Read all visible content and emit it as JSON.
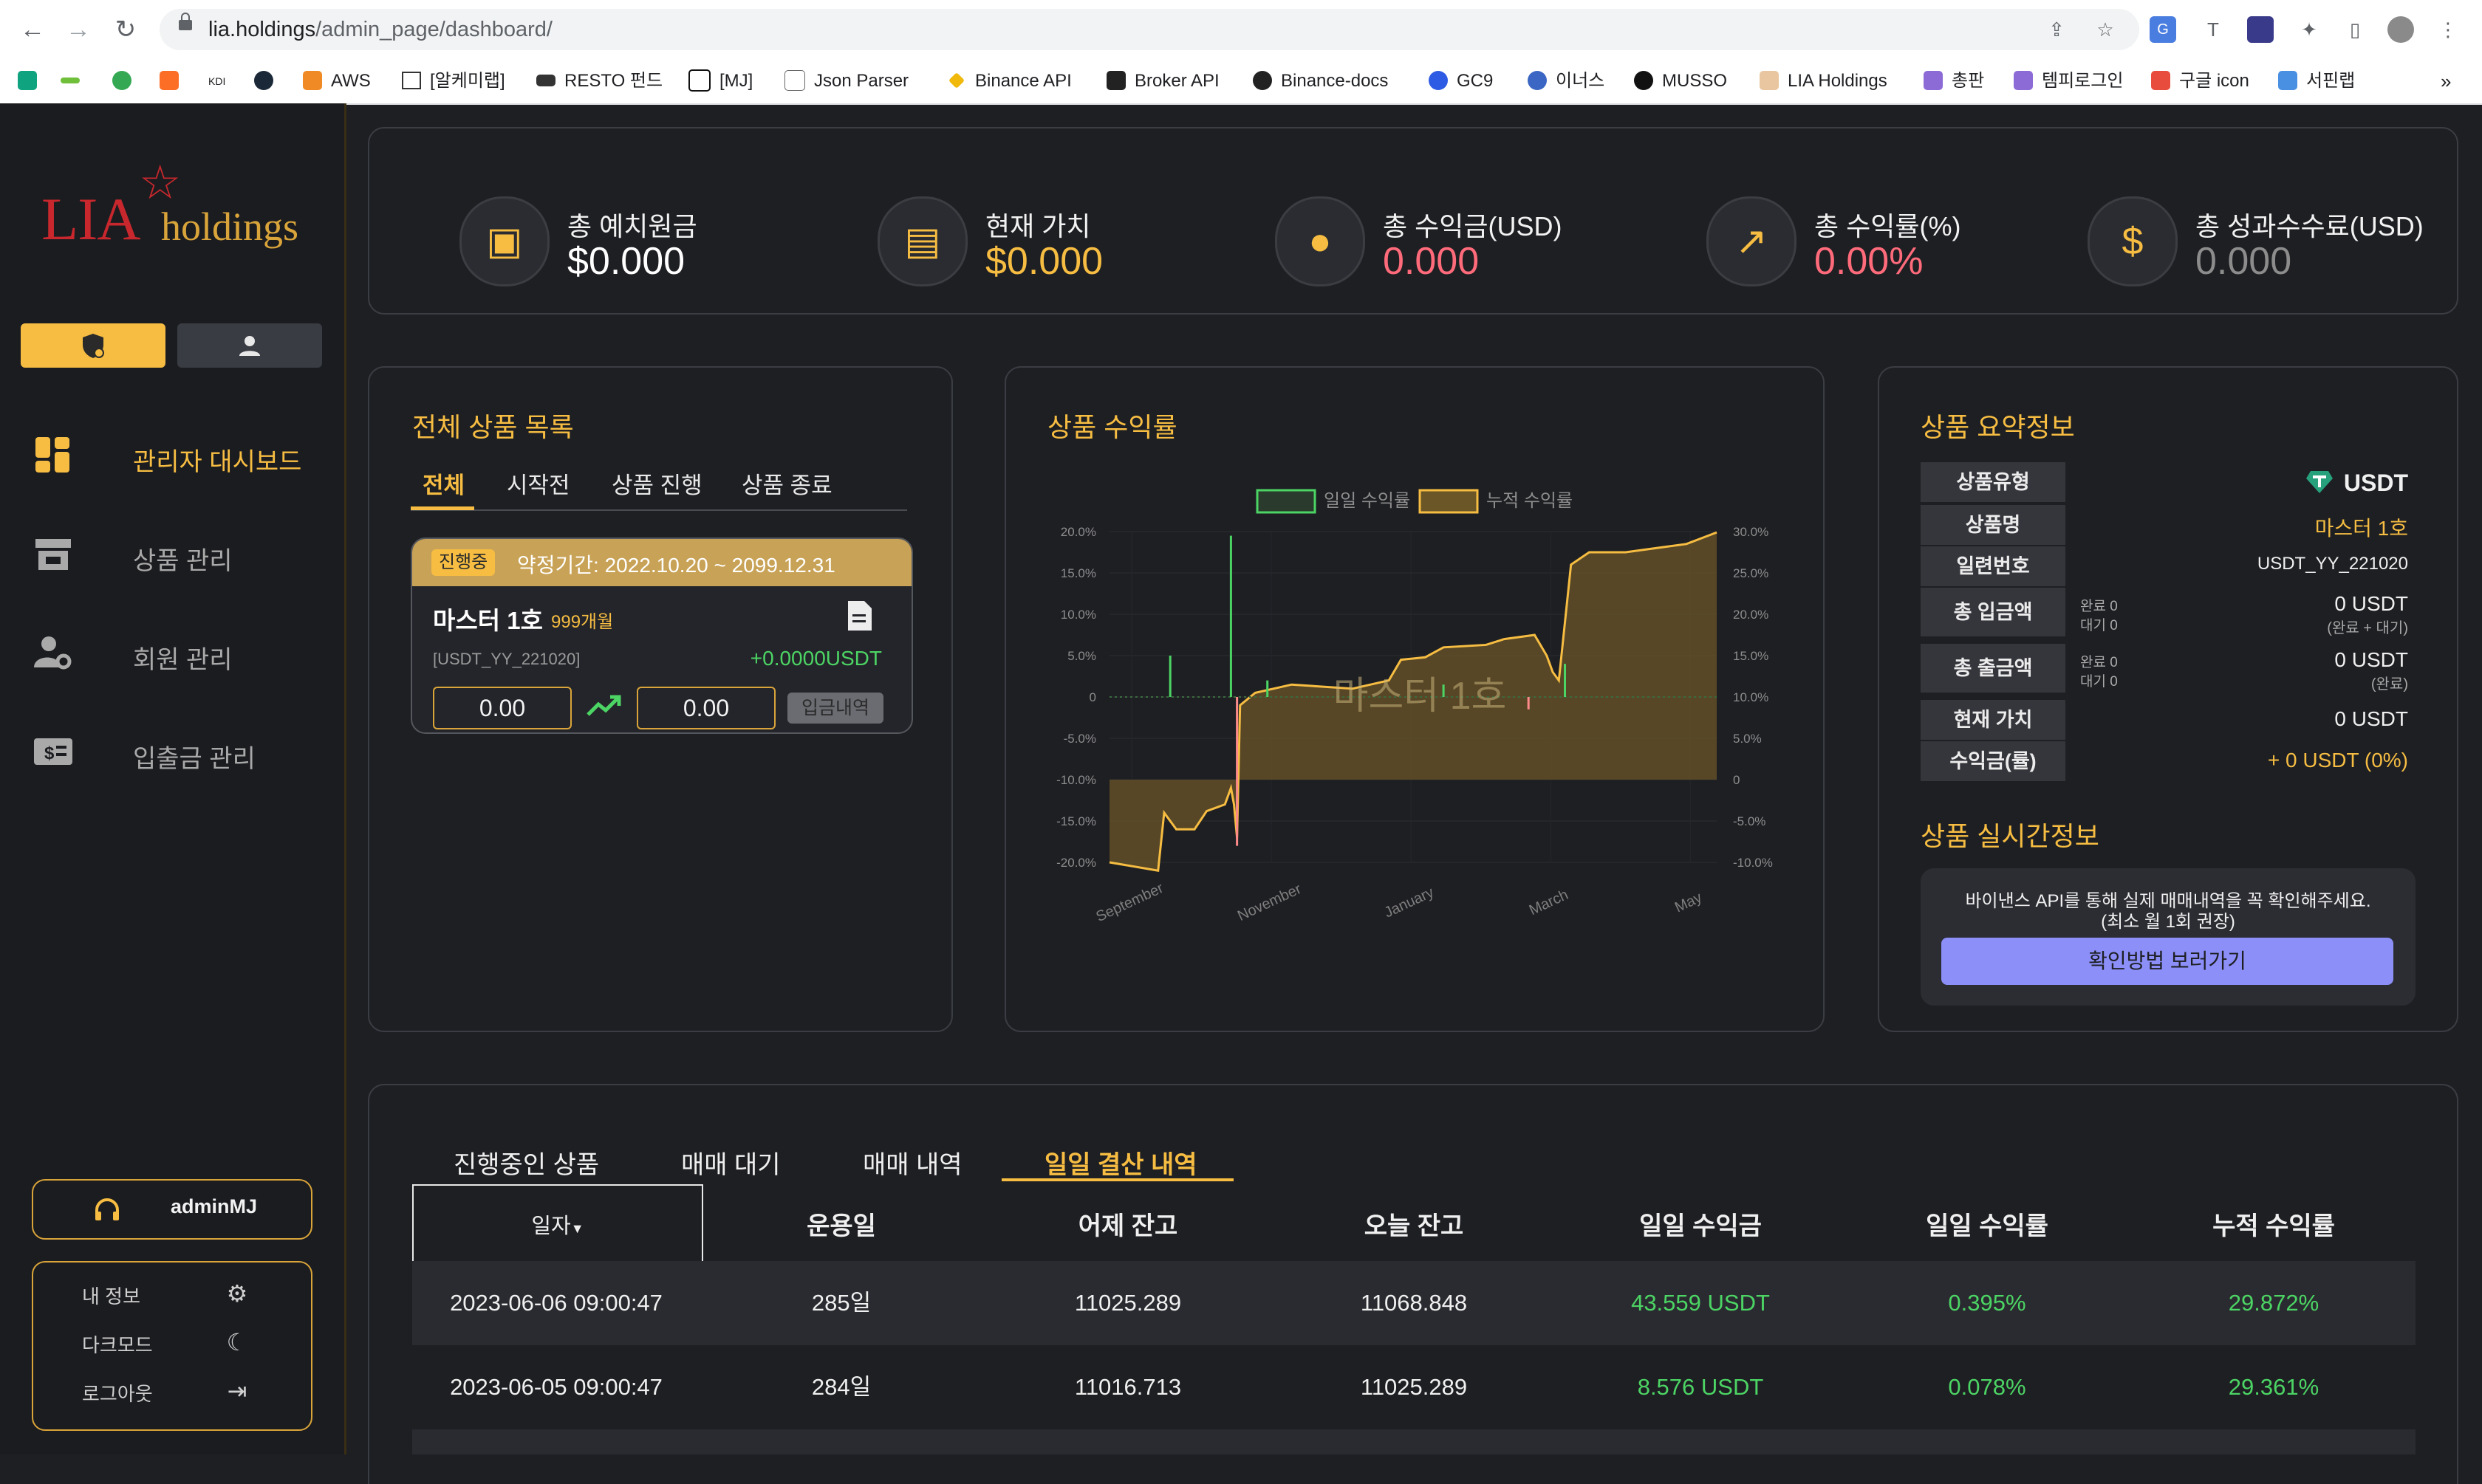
{
  "browser": {
    "url_host": "lia.holdings",
    "url_path": "/admin_page/dashboard/",
    "bookmarks": [
      "AWS",
      "[알케미랩]",
      "RESTO 펀드",
      "[MJ]",
      "Json Parser",
      "Binance API",
      "Broker API",
      "Binance-docs",
      "GC9",
      "이너스",
      "MUSSO",
      "LIA Holdings",
      "총판",
      "템피로그인",
      "구글 icon",
      "서핀랩"
    ]
  },
  "sidebar": {
    "logo_main": "LIA",
    "logo_sub": "holdings",
    "menu": [
      "관리자 대시보드",
      "상품 관리",
      "회원 관리",
      "입출금 관리"
    ],
    "username": "adminMJ",
    "user_menu": [
      "내 정보",
      "다크모드",
      "로그아웃"
    ]
  },
  "stats": [
    {
      "label": "총 예치원금",
      "value": "$0.000",
      "color": "#ffffff",
      "icon": "wallet-icon"
    },
    {
      "label": "현재 가치",
      "value": "$0.000",
      "color": "#f6bd42",
      "icon": "cash-icon"
    },
    {
      "label": "총 수익금(USD)",
      "value": "0.000",
      "color": "#ff6b7a",
      "icon": "piggy-bank-icon"
    },
    {
      "label": "총 수익률(%)",
      "value": "0.00%",
      "color": "#ff6b7a",
      "icon": "trending-up-icon"
    },
    {
      "label": "총 성과수수료(USD)",
      "value": "0.000",
      "color": "#8c8c8c",
      "icon": "dollar-bill-icon"
    }
  ],
  "product_list": {
    "title": "전체 상품 목록",
    "tabs": [
      "전체",
      "시작전",
      "상품 진행",
      "상품 종료"
    ],
    "card": {
      "status": "진행중",
      "period": "약정기간: 2022.10.20 ~ 2099.12.31",
      "name": "마스터 1호",
      "months": "999개월",
      "code": "[USDT_YY_221020]",
      "profit": "+0.0000USDT",
      "value_left": "0.00",
      "value_right": "0.00",
      "history_btn": "입금내역"
    }
  },
  "chart_panel": {
    "title": "상품 수익률",
    "watermark": "마스터 1호"
  },
  "chart_data": {
    "type": "bar",
    "title": "",
    "series": [
      {
        "name": "일일 수익률",
        "type": "bar",
        "color": "#4cd464",
        "axis": "left"
      },
      {
        "name": "누적 수익률",
        "type": "area",
        "color": "#f6bd42",
        "axis": "right"
      }
    ],
    "x_ticks": [
      "September",
      "November",
      "January",
      "March",
      "May"
    ],
    "y_left_ticks": [
      "20.0%",
      "15.0%",
      "10.0%",
      "5.0%",
      "0",
      "-5.0%",
      "-10.0%",
      "-15.0%",
      "-20.0%"
    ],
    "y_left_range": [
      -20,
      20
    ],
    "y_right_ticks": [
      "30.0%",
      "25.0%",
      "20.0%",
      "15.0%",
      "10.0%",
      "5.0%",
      "0",
      "-5.0%",
      "-10.0%"
    ],
    "y_right_range": [
      -10,
      30
    ],
    "daily_spikes": [
      {
        "x": 0.1,
        "v": 5.0
      },
      {
        "x": 0.2,
        "v": 19.5
      },
      {
        "x": 0.21,
        "v": -18.0
      },
      {
        "x": 0.75,
        "v": 4.0
      },
      {
        "x": 0.26,
        "v": 2.0
      },
      {
        "x": 0.55,
        "v": 1.5
      },
      {
        "x": 0.69,
        "v": -1.5
      }
    ],
    "cumulative": [
      [
        0.0,
        -10.0
      ],
      [
        0.08,
        -11.0
      ],
      [
        0.09,
        -4.0
      ],
      [
        0.11,
        -6.0
      ],
      [
        0.14,
        -6.0
      ],
      [
        0.16,
        -3.8
      ],
      [
        0.19,
        -3.0
      ],
      [
        0.2,
        -1.0
      ],
      [
        0.205,
        -3.0
      ],
      [
        0.21,
        -7.0
      ],
      [
        0.215,
        9.0
      ],
      [
        0.24,
        10.5
      ],
      [
        0.3,
        11.5
      ],
      [
        0.4,
        11.0
      ],
      [
        0.46,
        12.0
      ],
      [
        0.48,
        14.5
      ],
      [
        0.52,
        14.8
      ],
      [
        0.55,
        16.0
      ],
      [
        0.62,
        16.3
      ],
      [
        0.65,
        17.0
      ],
      [
        0.7,
        17.5
      ],
      [
        0.72,
        15.0
      ],
      [
        0.73,
        13.0
      ],
      [
        0.74,
        12.0
      ],
      [
        0.76,
        26.0
      ],
      [
        0.79,
        27.5
      ],
      [
        0.85,
        27.5
      ],
      [
        0.9,
        28.0
      ],
      [
        0.95,
        28.5
      ],
      [
        1.0,
        29.9
      ]
    ]
  },
  "summary": {
    "title": "상품 요약정보",
    "rows": [
      {
        "key": "상품유형",
        "value": "USDT"
      },
      {
        "key": "상품명",
        "value": "마스터 1호"
      },
      {
        "key": "일련번호",
        "value": "USDT_YY_221020"
      },
      {
        "key": "총 입금액",
        "value": "0 USDT",
        "sub1": "완료 0",
        "sub2": "대기 0",
        "note": "(완료 + 대기)"
      },
      {
        "key": "총 출금액",
        "value": "0 USDT",
        "sub1": "완료 0",
        "sub2": "대기 0",
        "note": "(완료)"
      },
      {
        "key": "현재 가치",
        "value": "0 USDT"
      },
      {
        "key": "수익금(률)",
        "value": "+ 0 USDT (0%)"
      }
    ],
    "realtime_title": "상품 실시간정보",
    "notice_line1": "바이낸스 API를 통해 실제 매매내역을 꼭 확인해주세요.",
    "notice_line2": "(최소 월 1회 권장)",
    "notice_button": "확인방법 보러가기"
  },
  "bottom": {
    "tabs": [
      "진행중인 상품",
      "매매 대기",
      "매매 내역",
      "일일 결산 내역"
    ],
    "headers": [
      "일자",
      "운용일",
      "어제 잔고",
      "오늘 잔고",
      "일일 수익금",
      "일일 수익률",
      "누적 수익률"
    ],
    "rows": [
      [
        "2023-06-06 09:00:47",
        "285일",
        "11025.289",
        "11068.848",
        "43.559 USDT",
        "0.395%",
        "29.872%"
      ],
      [
        "2023-06-05 09:00:47",
        "284일",
        "11016.713",
        "11025.289",
        "8.576 USDT",
        "0.078%",
        "29.361%"
      ]
    ]
  },
  "colors": {
    "accent": "#f6bd42",
    "positive": "#4cd464",
    "negative": "#ff6b7a",
    "button": "#8b8ff7"
  }
}
